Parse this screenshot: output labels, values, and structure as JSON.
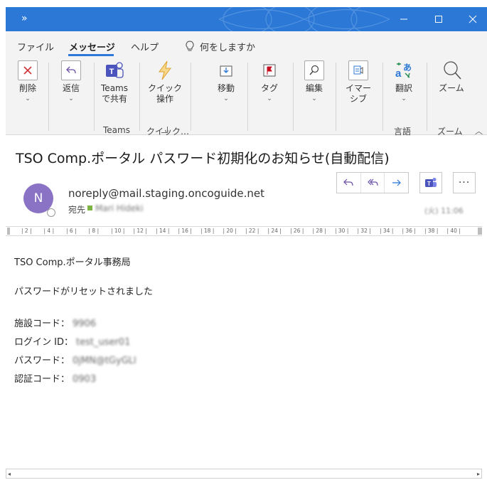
{
  "window": {
    "colors": {
      "titlebar": "#2b78d6",
      "accent": "#2b78d6",
      "avatar": "#8a72c5",
      "delete": "#d13438",
      "teams": "#4b53bc",
      "flag": "#c50f1f"
    }
  },
  "menu": {
    "tabs": [
      {
        "label": "ファイル"
      },
      {
        "label": "メッセージ"
      },
      {
        "label": "ヘルプ"
      }
    ],
    "tell_me": "何をしますか"
  },
  "ribbon": {
    "buttons": [
      {
        "label": "削除",
        "icon": "delete-x-icon"
      },
      {
        "label": "返信",
        "icon": "reply-icon"
      },
      {
        "label": "Teams\nで共有",
        "icon": "teams-icon"
      },
      {
        "label": "クイック\n操作",
        "icon": "lightning-icon"
      },
      {
        "label": "移動",
        "icon": "move-icon"
      },
      {
        "label": "タグ",
        "icon": "flag-icon"
      },
      {
        "label": "編集",
        "icon": "search-icon"
      },
      {
        "label": "イマー\nシブ",
        "icon": "immersive-reader-icon"
      },
      {
        "label": "翻訳",
        "icon": "translate-icon"
      },
      {
        "label": "ズーム",
        "icon": "zoom-icon"
      }
    ],
    "groups": [
      {
        "label": "Teams"
      },
      {
        "label": "クイック…"
      },
      {
        "label": "言語"
      },
      {
        "label": "ズーム"
      }
    ]
  },
  "message": {
    "subject": "TSO Comp.ポータル パスワード初期化のお知らせ(自動配信)",
    "avatar_initial": "N",
    "sender": "noreply@mail.staging.oncoguide.net",
    "to_label": "宛先",
    "to_value": "Mari Hideki",
    "date": "(火) 11:06"
  },
  "ruler": {
    "ticks": [
      "2",
      "4",
      "6",
      "8",
      "10",
      "12",
      "14",
      "16",
      "18",
      "20",
      "22",
      "24",
      "26",
      "28",
      "30",
      "32",
      "34",
      "36",
      "38",
      "40"
    ]
  },
  "body": {
    "line1": "TSO Comp.ポータル事務局",
    "line2": "パスワードがリセットされました",
    "fields": [
      {
        "label": "施設コード：",
        "value": "9906"
      },
      {
        "label": "ログイン ID：",
        "value": "test_user01"
      },
      {
        "label": "パスワード：",
        "value": "0jMN@tGyGLl"
      },
      {
        "label": "認証コード：",
        "value": "0903"
      }
    ]
  }
}
